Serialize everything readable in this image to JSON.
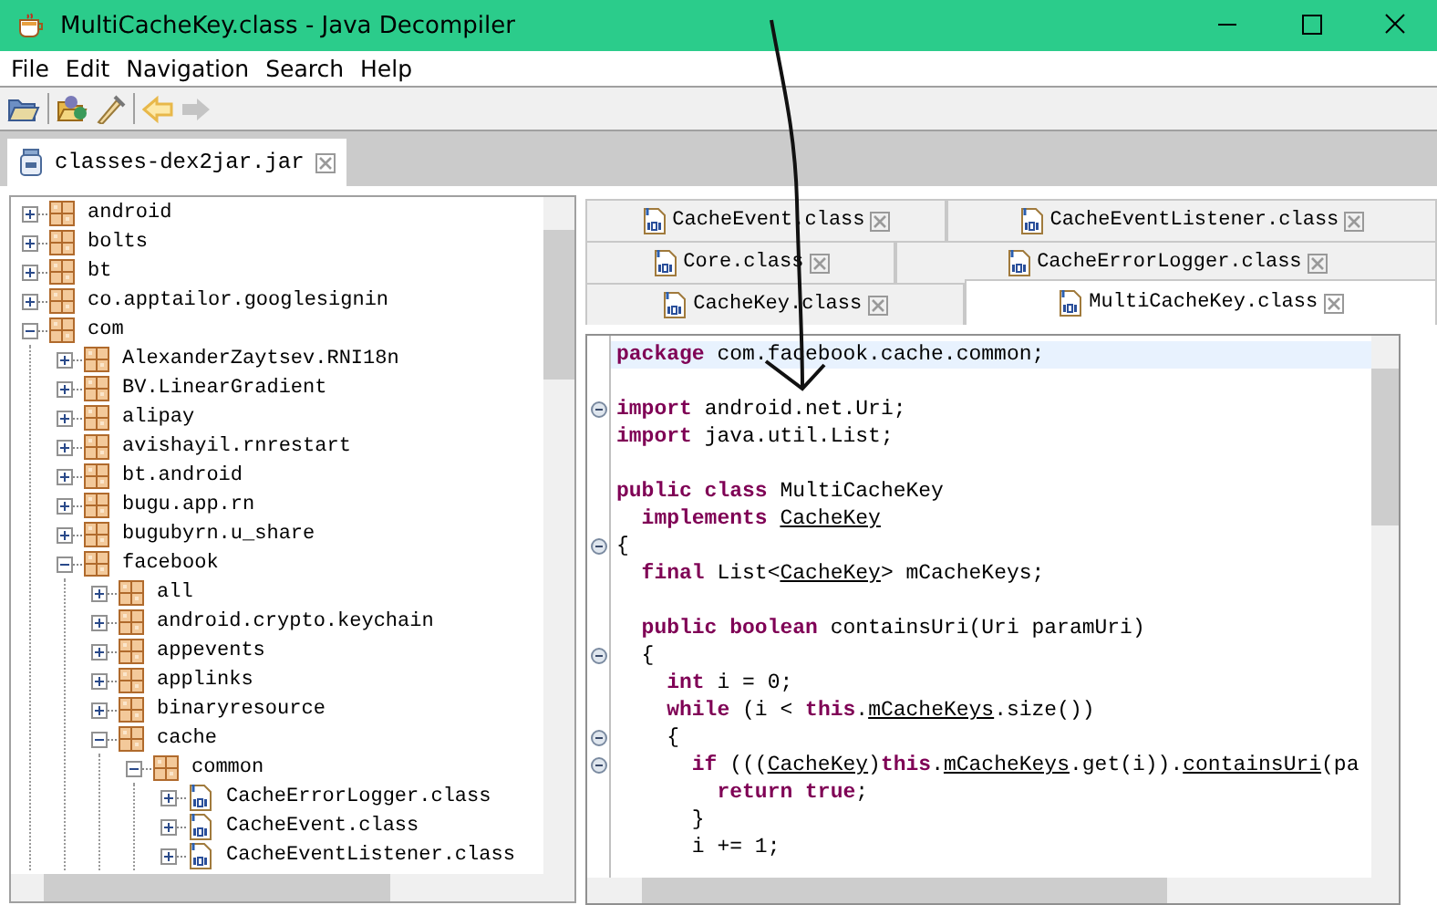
{
  "window": {
    "title": "MultiCacheKey.class - Java Decompiler"
  },
  "menu": [
    "File",
    "Edit",
    "Navigation",
    "Search",
    "Help"
  ],
  "toolbar": [
    {
      "items": [
        {
          "kind": "open",
          "disabled": false
        }
      ]
    },
    {
      "items": [
        {
          "kind": "open-type",
          "disabled": false
        },
        {
          "kind": "wand",
          "disabled": false
        }
      ]
    },
    {
      "items": [
        {
          "kind": "back",
          "disabled": false
        },
        {
          "kind": "forward",
          "disabled": true
        }
      ]
    }
  ],
  "file_tabs": [
    {
      "label": "classes-dex2jar.jar",
      "selected": true
    }
  ],
  "tree": [
    {
      "label": "android",
      "kind": "package",
      "expanded": false
    },
    {
      "label": "bolts",
      "kind": "package",
      "expanded": false
    },
    {
      "label": "bt",
      "kind": "package",
      "expanded": false
    },
    {
      "label": "co.apptailor.googlesignin",
      "kind": "package",
      "expanded": false
    },
    {
      "label": "com",
      "kind": "package",
      "expanded": true,
      "children": [
        {
          "label": "AlexanderZaytsev.RNI18n",
          "kind": "package",
          "expanded": false
        },
        {
          "label": "BV.LinearGradient",
          "kind": "package",
          "expanded": false
        },
        {
          "label": "alipay",
          "kind": "package",
          "expanded": false
        },
        {
          "label": "avishayil.rnrestart",
          "kind": "package",
          "expanded": false
        },
        {
          "label": "bt.android",
          "kind": "package",
          "expanded": false
        },
        {
          "label": "bugu.app.rn",
          "kind": "package",
          "expanded": false
        },
        {
          "label": "bugubyrn.u_share",
          "kind": "package",
          "expanded": false
        },
        {
          "label": "facebook",
          "kind": "package",
          "expanded": true,
          "children": [
            {
              "label": "all",
              "kind": "package",
              "expanded": false
            },
            {
              "label": "android.crypto.keychain",
              "kind": "package",
              "expanded": false
            },
            {
              "label": "appevents",
              "kind": "package",
              "expanded": false
            },
            {
              "label": "applinks",
              "kind": "package",
              "expanded": false
            },
            {
              "label": "binaryresource",
              "kind": "package",
              "expanded": false
            },
            {
              "label": "cache",
              "kind": "package",
              "expanded": true,
              "children": [
                {
                  "label": "common",
                  "kind": "package",
                  "expanded": true,
                  "children": [
                    {
                      "label": "CacheErrorLogger.class",
                      "kind": "class",
                      "expanded": false
                    },
                    {
                      "label": "CacheEvent.class",
                      "kind": "class",
                      "expanded": false
                    },
                    {
                      "label": "CacheEventListener.class",
                      "kind": "class",
                      "expanded": false
                    }
                  ]
                }
              ]
            }
          ]
        }
      ]
    }
  ],
  "editor_tabs": [
    {
      "tabs": [
        {
          "label": "CacheEvent.class",
          "selected": false
        },
        {
          "label": "CacheEventListener.class",
          "selected": false
        }
      ]
    },
    {
      "tabs": [
        {
          "label": "Core.class",
          "selected": false
        },
        {
          "label": "CacheErrorLogger.class",
          "selected": false
        }
      ]
    },
    {
      "tabs": [
        {
          "label": "CacheKey.class",
          "selected": false
        },
        {
          "label": "MultiCacheKey.class",
          "selected": true
        }
      ]
    }
  ],
  "code": {
    "lines": [
      {
        "fold": false,
        "current": true,
        "tokens": [
          {
            "kind": "keyword",
            "text": "package"
          },
          {
            "kind": "plain",
            "text": " com.facebook.cache.common;"
          }
        ]
      },
      {
        "fold": false,
        "current": false
      },
      {
        "fold": true,
        "current": false,
        "tokens": [
          {
            "kind": "keyword",
            "text": "import"
          },
          {
            "kind": "plain",
            "text": " android.net.Uri;"
          }
        ]
      },
      {
        "fold": false,
        "current": false,
        "tokens": [
          {
            "kind": "keyword",
            "text": "import"
          },
          {
            "kind": "plain",
            "text": " java.util.List;"
          }
        ]
      },
      {
        "fold": false,
        "current": false
      },
      {
        "fold": false,
        "current": false,
        "tokens": [
          {
            "kind": "keyword",
            "text": "public class"
          },
          {
            "kind": "plain",
            "text": " MultiCacheKey"
          }
        ]
      },
      {
        "fold": false,
        "current": false,
        "tokens": [
          {
            "kind": "keyword",
            "text": "  implements "
          },
          {
            "kind": "link",
            "text": "CacheKey"
          }
        ]
      },
      {
        "fold": true,
        "current": false,
        "tokens": [
          {
            "kind": "plain",
            "text": "{"
          }
        ]
      },
      {
        "fold": false,
        "current": false,
        "tokens": [
          {
            "kind": "keyword",
            "text": "  final"
          },
          {
            "kind": "plain",
            "text": " List<"
          },
          {
            "kind": "link",
            "text": "CacheKey"
          },
          {
            "kind": "plain",
            "text": "> mCacheKeys;"
          }
        ]
      },
      {
        "fold": false,
        "current": false
      },
      {
        "fold": false,
        "current": false,
        "tokens": [
          {
            "kind": "keyword",
            "text": "  public boolean"
          },
          {
            "kind": "plain",
            "text": " containsUri(Uri paramUri)"
          }
        ]
      },
      {
        "fold": true,
        "current": false,
        "tokens": [
          {
            "kind": "plain",
            "text": "  {"
          }
        ]
      },
      {
        "fold": false,
        "current": false,
        "tokens": [
          {
            "kind": "keyword",
            "text": "    int"
          },
          {
            "kind": "plain",
            "text": " i = 0;"
          }
        ]
      },
      {
        "fold": false,
        "current": false,
        "tokens": [
          {
            "kind": "keyword",
            "text": "    while"
          },
          {
            "kind": "plain",
            "text": " (i < "
          },
          {
            "kind": "keyword",
            "text": "this"
          },
          {
            "kind": "plain",
            "text": "."
          },
          {
            "kind": "link",
            "text": "mCacheKeys"
          },
          {
            "kind": "plain",
            "text": ".size())"
          }
        ]
      },
      {
        "fold": true,
        "current": false,
        "tokens": [
          {
            "kind": "plain",
            "text": "    {"
          }
        ]
      },
      {
        "fold": true,
        "current": false,
        "tokens": [
          {
            "kind": "keyword",
            "text": "      if"
          },
          {
            "kind": "plain",
            "text": " ((("
          },
          {
            "kind": "link",
            "text": "CacheKey"
          },
          {
            "kind": "plain",
            "text": ")"
          },
          {
            "kind": "keyword",
            "text": "this"
          },
          {
            "kind": "plain",
            "text": "."
          },
          {
            "kind": "link",
            "text": "mCacheKeys"
          },
          {
            "kind": "plain",
            "text": ".get(i))."
          },
          {
            "kind": "link",
            "text": "containsUri"
          },
          {
            "kind": "plain",
            "text": "(pa"
          }
        ]
      },
      {
        "fold": false,
        "current": false,
        "tokens": [
          {
            "kind": "keyword",
            "text": "        return true"
          },
          {
            "kind": "plain",
            "text": ";"
          }
        ]
      },
      {
        "fold": false,
        "current": false,
        "tokens": [
          {
            "kind": "plain",
            "text": "      }"
          }
        ]
      },
      {
        "fold": false,
        "current": false,
        "tokens": [
          {
            "kind": "plain",
            "text": "      i += 1;"
          }
        ]
      }
    ]
  }
}
